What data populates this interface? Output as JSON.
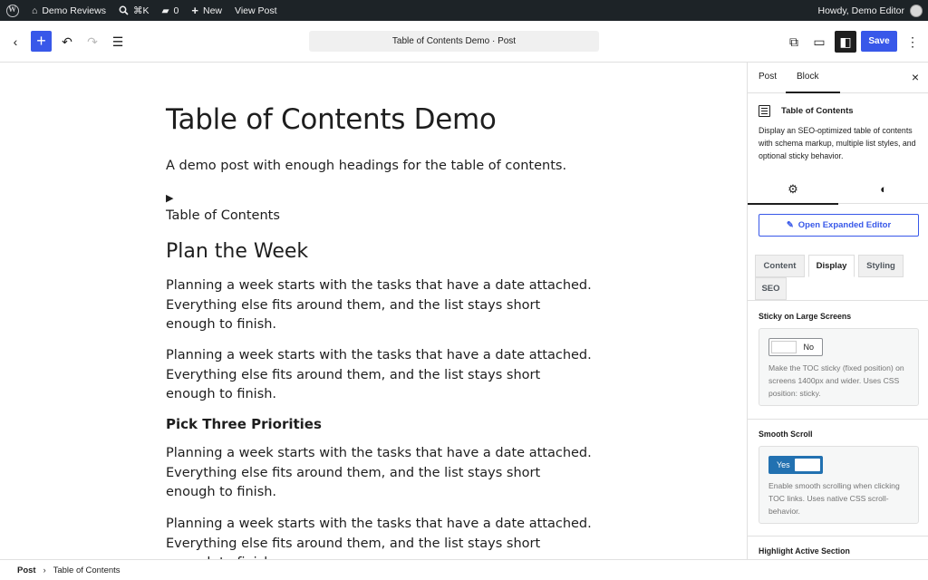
{
  "admin_bar": {
    "site_name": "Demo Reviews",
    "search_shortcut": "⌘K",
    "comments_count": "0",
    "new_label": "New",
    "view_post_label": "View Post",
    "greeting": "Howdy, Demo Editor"
  },
  "editor_header": {
    "document_title": "Table of Contents Demo · Post",
    "save_label": "Save"
  },
  "post": {
    "title": "Table of Contents Demo",
    "excerpt": "A demo post with enough headings for the table of contents.",
    "toc_label": "Table of Contents",
    "heading_2": "Plan the Week",
    "heading_3": "Pick Three Priorities",
    "paragraphs": [
      "Planning a week starts with the tasks that have a date attached. Everything else fits around them, and the list stays short enough to finish.",
      "Planning a week starts with the tasks that have a date attached. Everything else fits around them, and the list stays short enough to finish.",
      "Planning a week starts with the tasks that have a date attached. Everything else fits around them, and the list stays short enough to finish.",
      "Planning a week starts with the tasks that have a date attached. Everything else fits around them, and the list stays short enough to finish."
    ]
  },
  "sidebar": {
    "tabs": [
      "Post",
      "Block"
    ],
    "active_tab": "Block",
    "block_name": "Table of Contents",
    "block_description": "Display an SEO-optimized table of contents with schema markup, multiple list styles, and optional sticky behavior.",
    "expand_button_label": "Open Expanded Editor",
    "panel_tabs": [
      "Content",
      "Display",
      "Styling",
      "SEO"
    ],
    "active_panel_tab": "Display",
    "sections": [
      {
        "title": "Sticky on Large Screens",
        "toggle_label": "No",
        "toggle_state": "off",
        "help": "Make the TOC sticky (fixed position) on screens 1400px and wider. Uses CSS position: sticky."
      },
      {
        "title": "Smooth Scroll",
        "toggle_label": "Yes",
        "toggle_state": "on",
        "help": "Enable smooth scrolling when clicking TOC links. Uses native CSS scroll-behavior."
      },
      {
        "title": "Highlight Active Section"
      }
    ]
  },
  "breadcrumb": {
    "root": "Post",
    "separator": "›",
    "current": "Table of Contents"
  },
  "colors": {
    "admin_bar_bg": "#1d2327",
    "accent": "#3858e9",
    "toggle_on": "#2271b1"
  }
}
